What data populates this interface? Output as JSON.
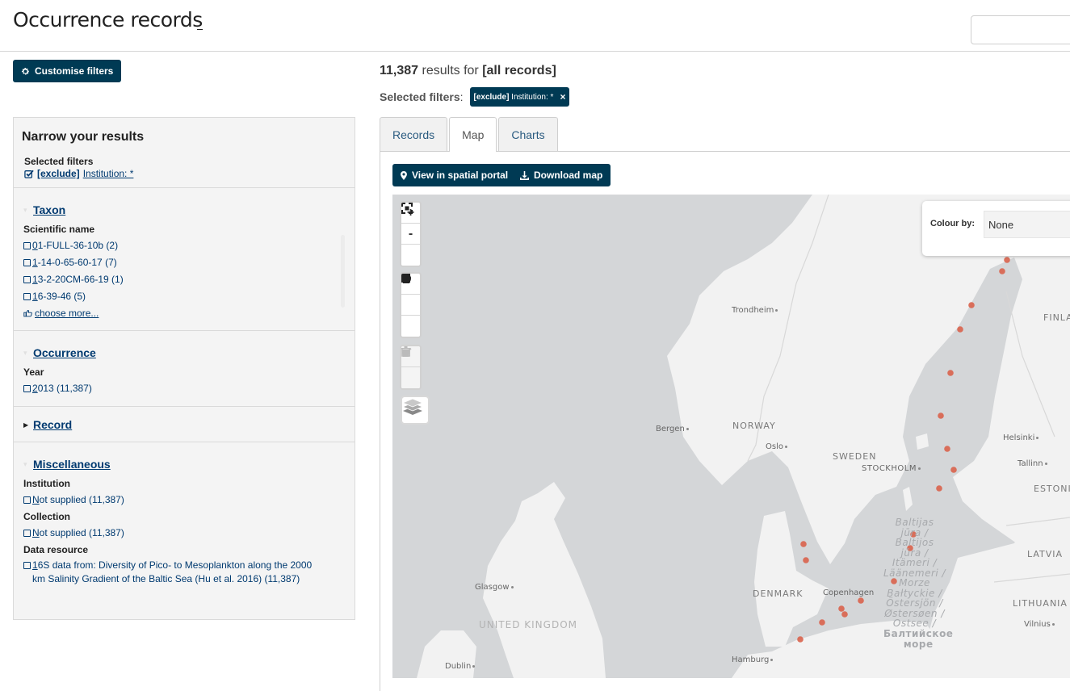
{
  "header": {
    "title": "Occurrence records"
  },
  "left": {
    "customise_button": "Customise filters",
    "panel_title": "Narrow your results",
    "selected_filters_label": "Selected filters",
    "selected_filter": {
      "prefix": "[exclude]",
      "rest": " Institution: *"
    },
    "choose_more": " choose more...",
    "sections": {
      "taxon": {
        "title": "Taxon",
        "label": "Scientific name",
        "items": [
          {
            "first": "0",
            "rest": "1-FULL-36-10b (2)"
          },
          {
            "first": "1",
            "rest": "-14-0-65-60-17 (7)"
          },
          {
            "first": "1",
            "rest": "3-2-20CM-66-19 (1)"
          },
          {
            "first": "1",
            "rest": "6-39-46 (5)"
          }
        ]
      },
      "occurrence": {
        "title": "Occurrence",
        "label": "Year",
        "items": [
          {
            "first": "2",
            "rest": "013 (11,387)"
          }
        ]
      },
      "record": {
        "title": "Record"
      },
      "misc": {
        "title": "Miscellaneous",
        "institution_label": "Institution",
        "institution_item": {
          "first": "N",
          "rest": "ot supplied (11,387)"
        },
        "collection_label": "Collection",
        "collection_item": {
          "first": "N",
          "rest": "ot supplied (11,387)"
        },
        "resource_label": "Data resource",
        "resource_item": {
          "first": "1",
          "rest": "6S data from: Diversity of Pico- to Mesoplankton along the 2000 km Salinity Gradient of the Baltic Sea (Hu et al. 2016) (11,387)"
        }
      }
    }
  },
  "results": {
    "count": "11,387",
    "results_for": " results for ",
    "query": "[all records]",
    "selected_filters_label": "Selected filters",
    "chip": {
      "prefix": "[exclude]",
      "rest": " Institution: *",
      "close": "×"
    }
  },
  "tabs": [
    {
      "label": "Records"
    },
    {
      "label": "Map"
    },
    {
      "label": "Charts"
    }
  ],
  "map": {
    "spatial_button": "View in spatial portal",
    "download_button": "Download map",
    "zoom_in": "+",
    "zoom_out": "-",
    "colour_by_label": "Colour by:",
    "colour_by_value": "None",
    "point_color": "#d9634d",
    "labels": {
      "trondheim": "Trondheim",
      "bergen": "Bergen",
      "oslo": "Oslo",
      "norway": "NORWAY",
      "sweden": "SWEDEN",
      "stockholm": "STOCKHOLM",
      "helsinki": "Helsinki",
      "tallinn": "Tallinn",
      "estonia": "ESTONI",
      "finland": "FINLA",
      "latvia": "LATVIA",
      "lithuania": "LITHUANIA",
      "vilnius": "Vilnius",
      "denmark": "DENMARK",
      "copenhagen": "Copenhagen",
      "glasgow": "Glasgow",
      "uk": "UNITED KINGDOM",
      "dublin": "Dublin",
      "hamburg": "Hamburg",
      "sea": "Baltijas\njūra /\nBaltijos\njūra /\nItämeri /\nLäänemeri /\nMorze\nBałtyckie /\nÖstersjön /\nØstersøen /\nOstsee /",
      "sea_ru": "Балтийское\nморе"
    }
  }
}
